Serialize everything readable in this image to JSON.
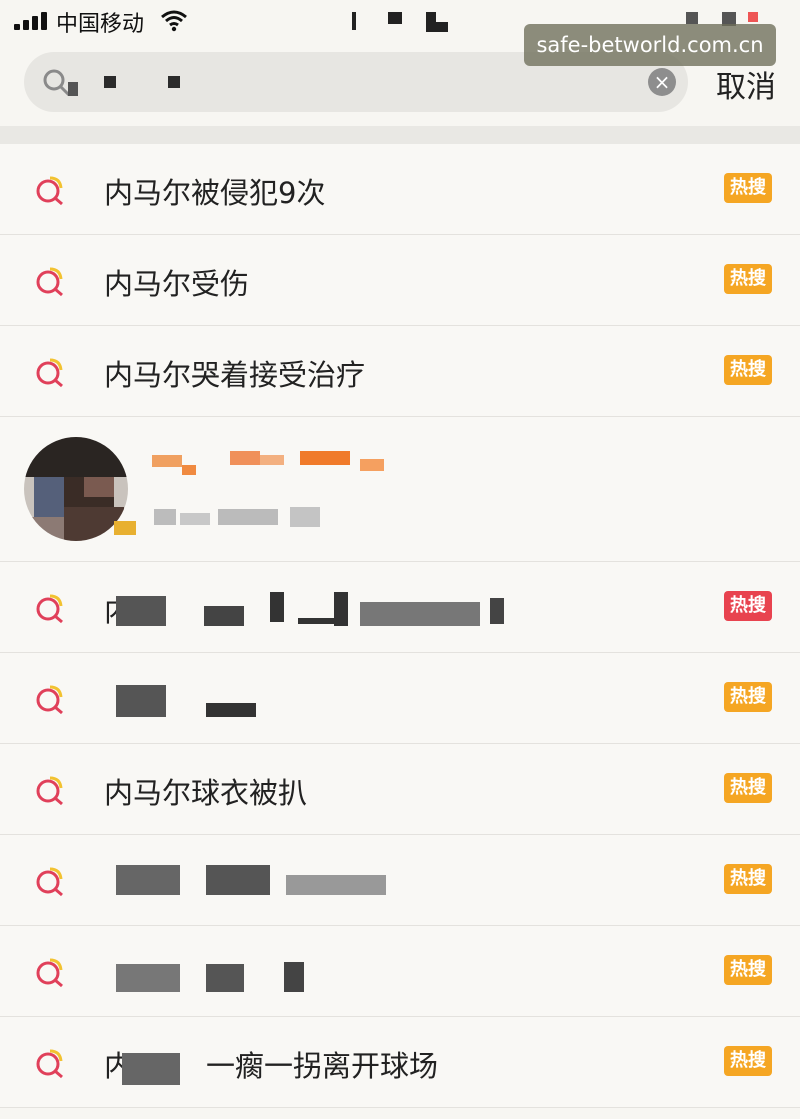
{
  "status_bar": {
    "carrier": "中国移动"
  },
  "watermark": "safe-betworld.com.cn",
  "search": {
    "placeholder": "",
    "clear_icon": "×",
    "cancel_label": "取消"
  },
  "results": [
    {
      "text": "内马尔被侵犯9次",
      "badge": "热搜",
      "badge_color": "#f5a623"
    },
    {
      "text": "内马尔受伤",
      "badge": "热搜",
      "badge_color": "#f5a623"
    },
    {
      "text": "内马尔哭着接受治疗",
      "badge": "热搜",
      "badge_color": "#f5a623"
    }
  ],
  "results_after_user": [
    {
      "text": "内",
      "badge": "热搜",
      "badge_color": "#e8434f"
    },
    {
      "text": "",
      "badge": "热搜",
      "badge_color": "#f5a623"
    },
    {
      "text": "内马尔球衣被扒",
      "badge": "热搜",
      "badge_color": "#f5a623"
    },
    {
      "text": "",
      "badge": "热搜",
      "badge_color": "#f5a623"
    },
    {
      "text": "",
      "badge": "热搜",
      "badge_color": "#f5a623"
    },
    {
      "text": "内",
      "text_suffix": "一瘸一拐离开球场",
      "badge": "热搜",
      "badge_color": "#f5a623"
    }
  ],
  "colors": {
    "hot_orange": "#f5a623",
    "hot_red": "#e8434f",
    "icon_red": "#e0405a",
    "icon_yellow": "#f2c230"
  }
}
